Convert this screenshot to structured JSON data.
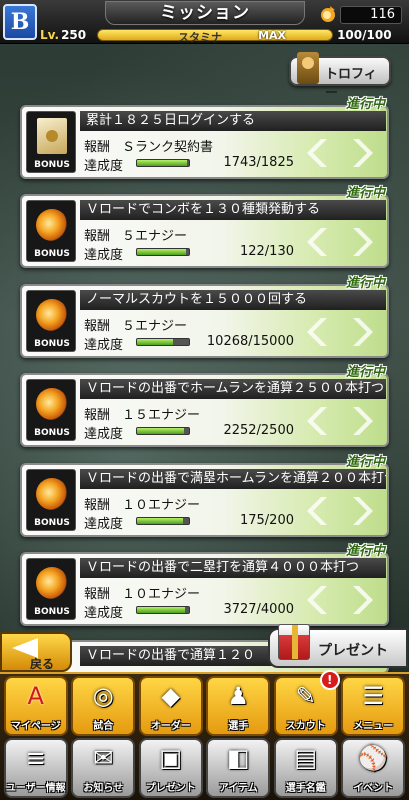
{
  "header": {
    "title": "ミッション",
    "team_logo": "B",
    "energy_icon": "flame-icon",
    "energy_count": "116",
    "level_label": "Lv.",
    "level": "250",
    "stamina_label": "スタミナ",
    "stamina_max_label": "MAX",
    "stamina_value": "100/100"
  },
  "trophy": {
    "label": "トロフィー",
    "icon": "trophy-icon"
  },
  "missions": [
    {
      "status": "進行中",
      "icon": "contract",
      "bonus": "BONUS",
      "title": "累計１８２５日ログインする",
      "reward_key": "報酬",
      "reward": "Ｓランク契約書",
      "progress_key": "達成度",
      "progress": "1743/1825",
      "ratio": 0.955
    },
    {
      "status": "進行中",
      "icon": "flame",
      "bonus": "BONUS",
      "title": "Ｖロードでコンボを１３０種類発動する",
      "reward_key": "報酬",
      "reward": "５エナジー",
      "progress_key": "達成度",
      "progress": "122/130",
      "ratio": 0.938
    },
    {
      "status": "進行中",
      "icon": "flame",
      "bonus": "BONUS",
      "title": "ノーマルスカウトを１５０００回する",
      "reward_key": "報酬",
      "reward": "５エナジー",
      "progress_key": "達成度",
      "progress": "10268/15000",
      "ratio": 0.685
    },
    {
      "status": "進行中",
      "icon": "flame",
      "bonus": "BONUS",
      "title": "Ｖロードの出番でホームランを通算２５００本打つ",
      "reward_key": "報酬",
      "reward": "１５エナジー",
      "progress_key": "達成度",
      "progress": "2252/2500",
      "ratio": 0.9
    },
    {
      "status": "進行中",
      "icon": "flame",
      "bonus": "BONUS",
      "title": "Ｖロードの出番で満塁ホームランを通算２００本打つ",
      "reward_key": "報酬",
      "reward": "１０エナジー",
      "progress_key": "達成度",
      "progress": "175/200",
      "ratio": 0.875
    },
    {
      "status": "進行中",
      "icon": "flame",
      "bonus": "BONUS",
      "title": "Ｖロードの出番で二塁打を通算４０００本打つ",
      "reward_key": "報酬",
      "reward": "１０エナジー",
      "progress_key": "達成度",
      "progress": "3727/4000",
      "ratio": 0.93
    }
  ],
  "partial_mission": {
    "title": "Ｖロードの出番で通算１２０"
  },
  "back": {
    "label": "戻る"
  },
  "present": {
    "label": "プレゼント"
  },
  "nav": {
    "row1": [
      {
        "label": "マイページ",
        "icon": "mypage-icon",
        "glyph": "A"
      },
      {
        "label": "試合",
        "icon": "stadium-icon",
        "glyph": "◎"
      },
      {
        "label": "オーダー",
        "icon": "field-icon",
        "glyph": "◆"
      },
      {
        "label": "選手",
        "icon": "player-icon",
        "glyph": "♟"
      },
      {
        "label": "スカウト",
        "icon": "scout-icon",
        "glyph": "✎",
        "badge": "!"
      },
      {
        "label": "メニュー",
        "icon": "menu-icon",
        "glyph": "☰"
      }
    ],
    "row2": [
      {
        "label": "ユーザー情報",
        "icon": "user-info-icon",
        "glyph": "≡"
      },
      {
        "label": "お知らせ",
        "icon": "notice-icon",
        "glyph": "✉"
      },
      {
        "label": "プレゼント",
        "icon": "gift-icon",
        "glyph": "▣"
      },
      {
        "label": "アイテム",
        "icon": "item-icon",
        "glyph": "◧"
      },
      {
        "label": "選手名鑑",
        "icon": "book-icon",
        "glyph": "▤"
      },
      {
        "label": "イベント",
        "icon": "event-icon",
        "glyph": "⚾"
      }
    ]
  }
}
